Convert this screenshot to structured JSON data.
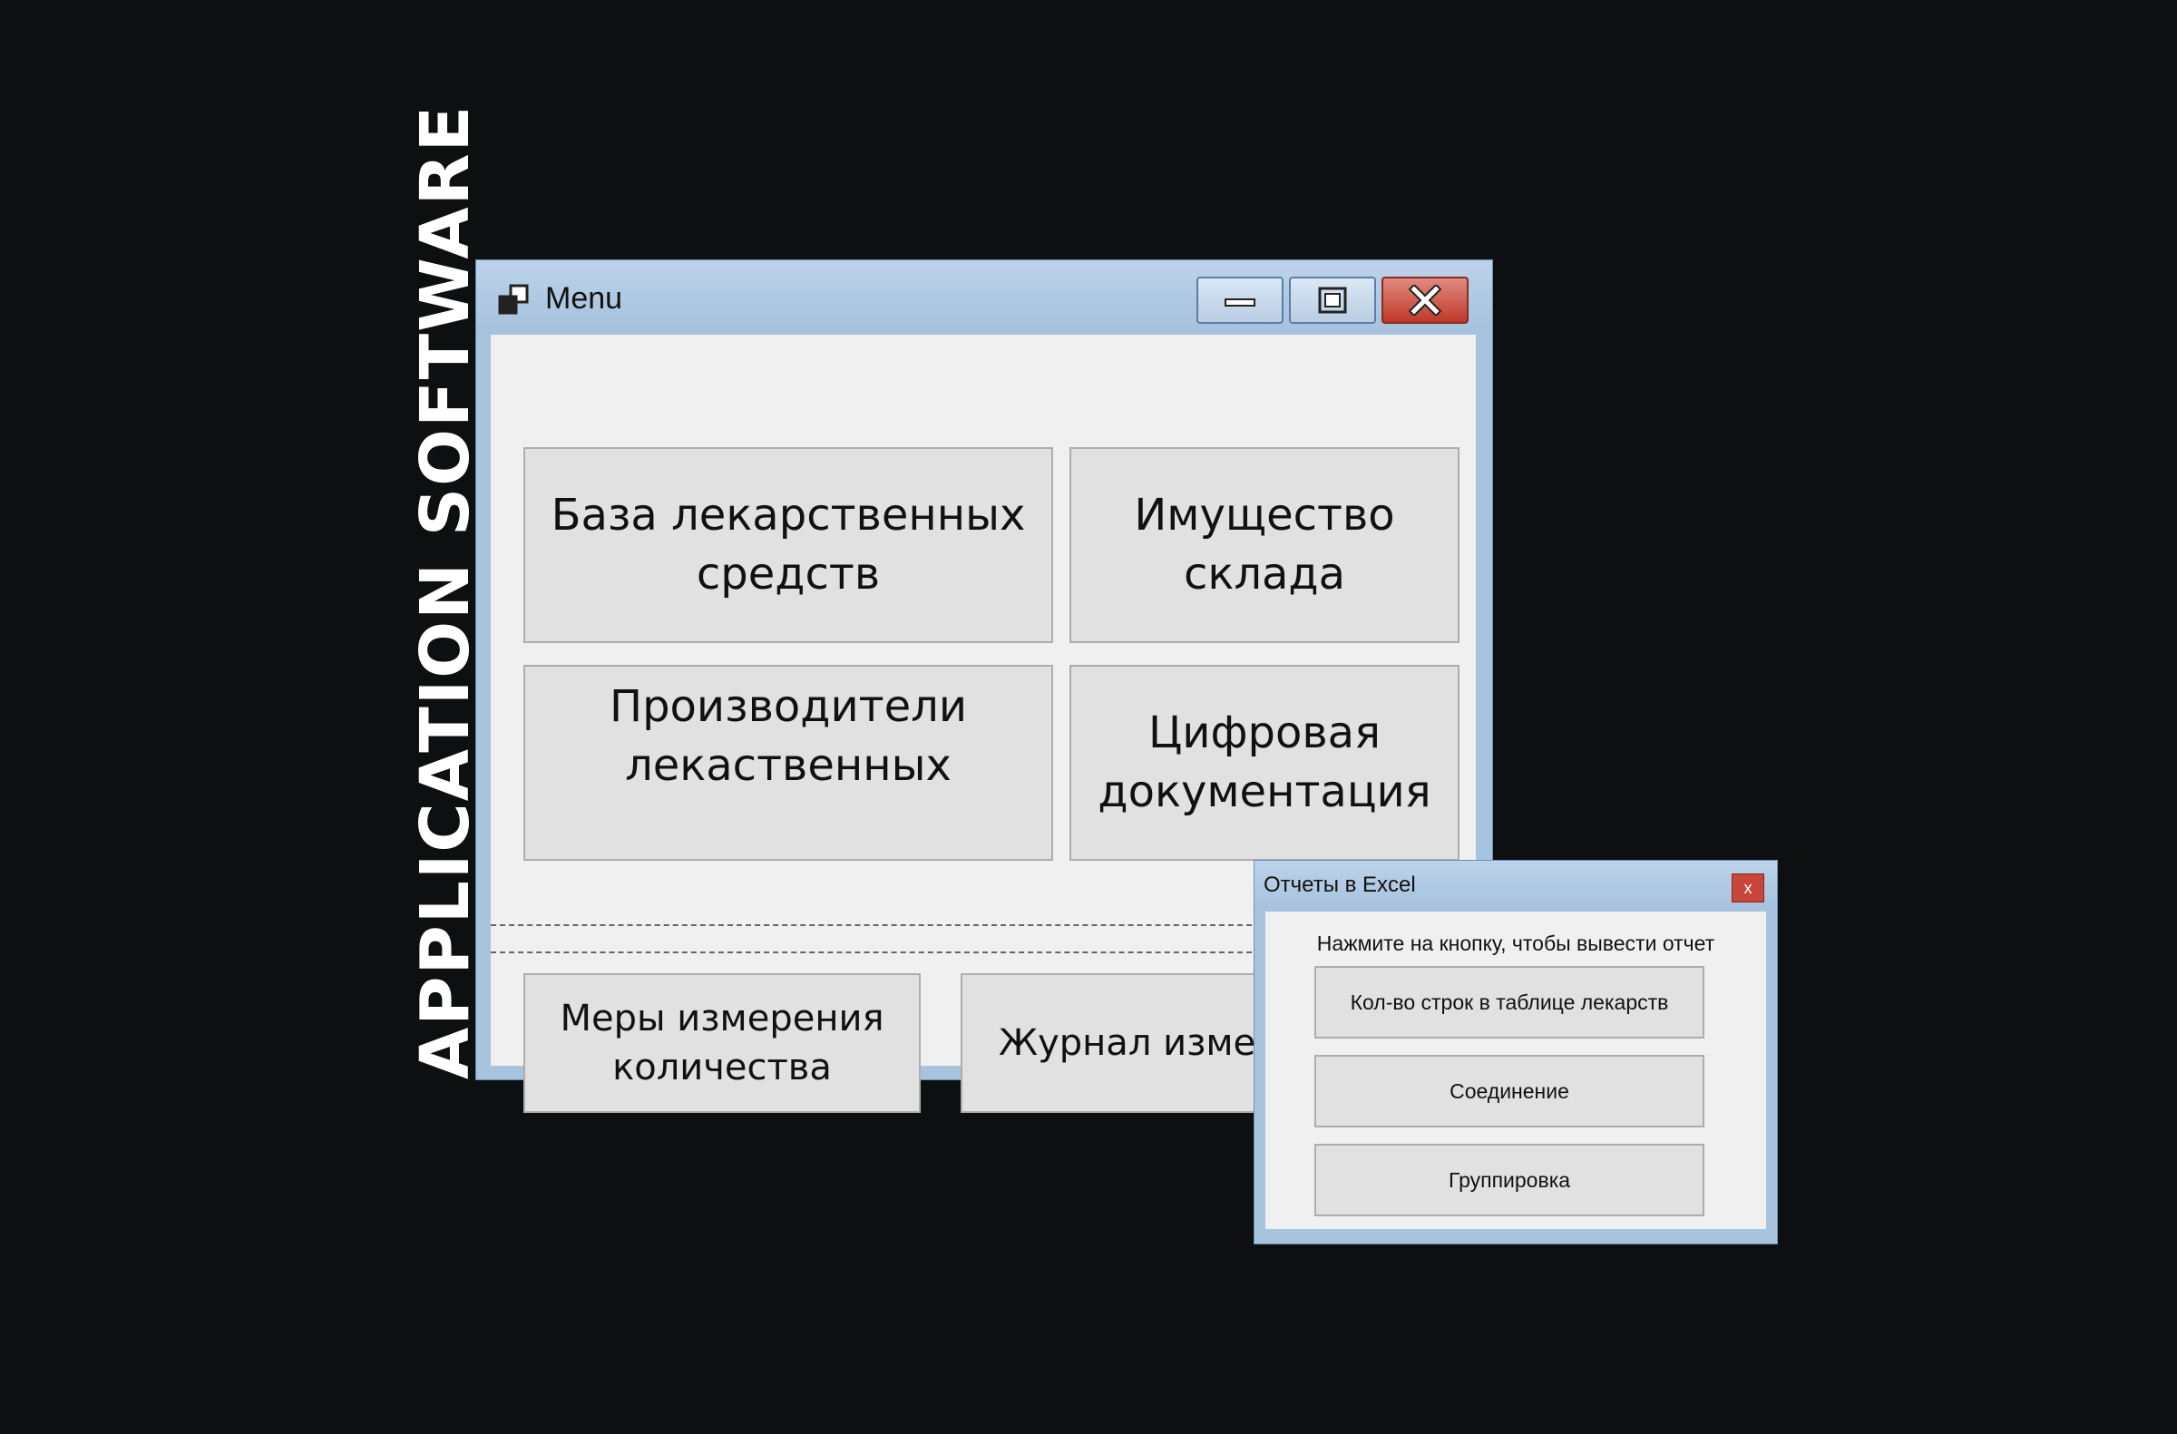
{
  "side_heading": "APPLICATION SOFTWARE",
  "main_window": {
    "title": "Menu",
    "buttons": {
      "medicines_db": "База лекарственных\nсредств",
      "warehouse_property": "Имущество\nсклада",
      "manufacturers": "Производители\nлекаственных",
      "digital_docs": "Цифровая\nдокументация",
      "measures": "Меры измерения\nколичества",
      "change_log": "Журнал измен"
    }
  },
  "excel_dialog": {
    "title": "Отчеты в Excel",
    "close_label": "x",
    "instruction": "Нажмите на кнопку, чтобы вывести отчет",
    "buttons": {
      "row_count": "Кол-во строк в таблице лекарств",
      "join": "Соединение",
      "grouping": "Группировка"
    }
  },
  "colors": {
    "background": "#0e0f11",
    "window_frame": "#a8c3de",
    "client_area": "#f0f0f0",
    "button_face": "#e1e1e1",
    "close_button": "#c0392b"
  }
}
